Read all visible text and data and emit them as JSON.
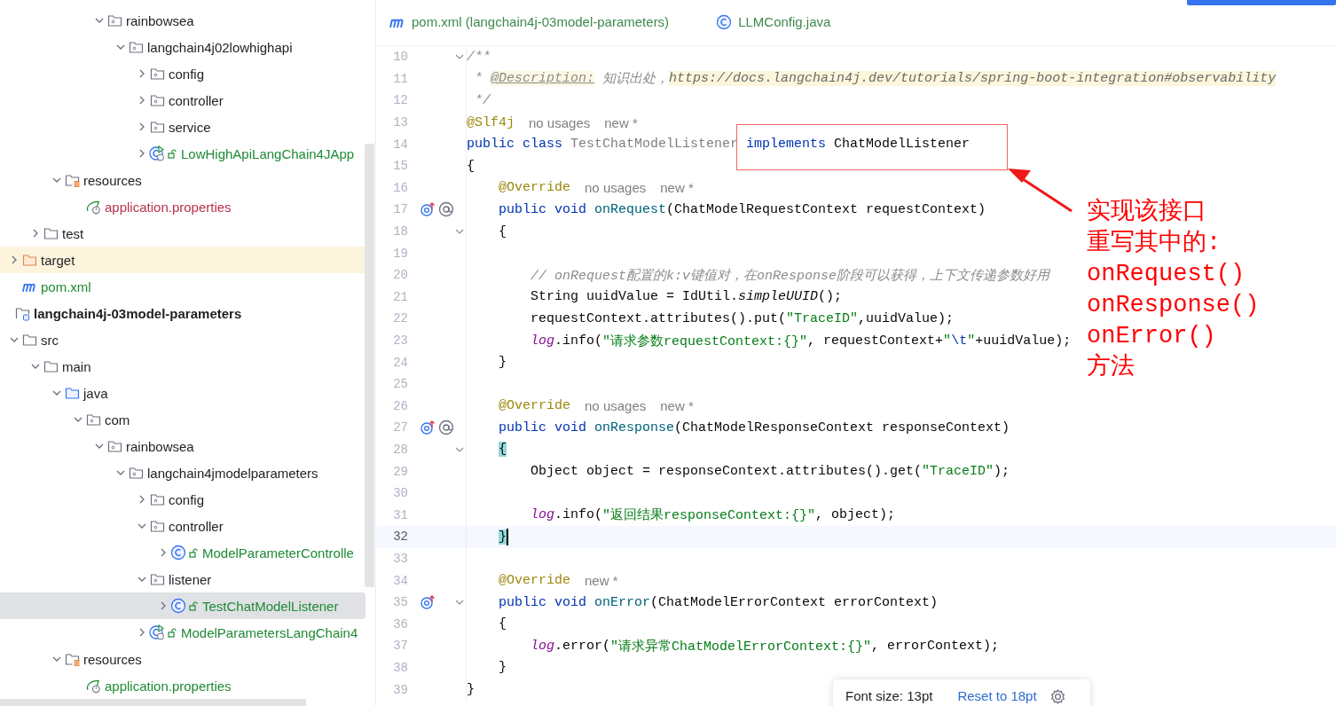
{
  "project_tree": [
    {
      "label": "rainbowsea",
      "kind": "package",
      "expanded": true,
      "selected": false,
      "children": [
        {
          "label": "langchain4j02lowhighapi",
          "kind": "package",
          "expanded": true,
          "selected": false,
          "children": [
            {
              "label": "config",
              "kind": "package",
              "expanded": false,
              "selected": false
            },
            {
              "label": "controller",
              "kind": "package",
              "expanded": false,
              "selected": false
            },
            {
              "label": "service",
              "kind": "package",
              "expanded": false,
              "selected": false
            },
            {
              "label": "LowHighApiLangChain4JApp",
              "kind": "spring-app",
              "expanded": false,
              "selected": false,
              "color": "#1f8a34"
            }
          ]
        }
      ]
    },
    {
      "label": "resources",
      "kind": "resource-folder",
      "expanded": true,
      "selected": false,
      "children": [
        {
          "label": "application.properties",
          "kind": "properties",
          "selected": false,
          "color": "#b8304f"
        }
      ]
    },
    {
      "label": "test",
      "kind": "folder",
      "expanded": false,
      "selected": false
    },
    {
      "label": "target",
      "kind": "excluded-folder",
      "expanded": false,
      "selected": false
    },
    {
      "label": "pom.xml",
      "kind": "maven",
      "selected": false,
      "color": "#1f8a34"
    },
    {
      "label": "langchain4j-03model-parameters",
      "kind": "module",
      "selected": false,
      "children": [
        {
          "label": "src",
          "kind": "folder",
          "expanded": true,
          "selected": false,
          "children": [
            {
              "label": "main",
              "kind": "folder",
              "expanded": true,
              "selected": false,
              "children": [
                {
                  "label": "java",
                  "kind": "source-folder",
                  "expanded": true,
                  "selected": false,
                  "children": [
                    {
                      "label": "com",
                      "kind": "package",
                      "expanded": true,
                      "selected": false,
                      "children": [
                        {
                          "label": "rainbowsea",
                          "kind": "package",
                          "expanded": true,
                          "selected": false,
                          "children": [
                            {
                              "label": "langchain4jmodelparameters",
                              "kind": "package",
                              "expanded": true,
                              "selected": false,
                              "children": [
                                {
                                  "label": "config",
                                  "kind": "package",
                                  "expanded": false,
                                  "selected": false
                                },
                                {
                                  "label": "controller",
                                  "kind": "package",
                                  "expanded": true,
                                  "selected": false,
                                  "children": [
                                    {
                                      "label": "ModelParameterControlle",
                                      "kind": "class",
                                      "expanded": false,
                                      "selected": false,
                                      "color": "#1f8a34"
                                    }
                                  ]
                                },
                                {
                                  "label": "listener",
                                  "kind": "package",
                                  "expanded": true,
                                  "selected": false,
                                  "children": [
                                    {
                                      "label": "TestChatModelListener",
                                      "kind": "class",
                                      "expanded": false,
                                      "selected": true,
                                      "color": "#1f8a34"
                                    }
                                  ]
                                },
                                {
                                  "label": "ModelParametersLangChain4",
                                  "kind": "spring-app",
                                  "expanded": false,
                                  "selected": false,
                                  "color": "#1f8a34"
                                }
                              ]
                            }
                          ]
                        }
                      ]
                    }
                  ]
                },
                {
                  "label": "resources",
                  "kind": "resource-folder",
                  "expanded": true,
                  "selected": false,
                  "children": [
                    {
                      "label": "application.properties",
                      "kind": "properties",
                      "selected": false,
                      "color": "#1f8a34"
                    }
                  ]
                }
              ]
            }
          ]
        }
      ]
    }
  ],
  "tabs": [
    {
      "label": "pom.xml (langchain4j-03model-parameters)",
      "kind": "maven",
      "selected": false
    },
    {
      "label": "LLMConfig.java",
      "kind": "class",
      "selected": false
    }
  ],
  "code_lines": [
    {
      "number": "10",
      "gutter": [
        {
          "kind": "fold"
        }
      ],
      "current": false,
      "tokens": [
        {
          "kind": "comment",
          "text": "/**"
        }
      ]
    },
    {
      "number": "11",
      "current": false,
      "tokens": [
        {
          "kind": "comment",
          "text": " * "
        },
        {
          "kind": "doc-tag",
          "text": "@Description:"
        },
        {
          "kind": "comment",
          "text": " 知识出处，"
        },
        {
          "kind": "link",
          "text": "https://docs.langchain4j.dev/tutorials/spring-boot-integration#observability"
        }
      ]
    },
    {
      "number": "12",
      "current": false,
      "tokens": [
        {
          "kind": "comment",
          "text": " */"
        }
      ]
    },
    {
      "number": "13",
      "current": false,
      "tokens": [
        {
          "kind": "annotation",
          "text": "@Slf4j"
        },
        {
          "kind": "hint",
          "text": "no usages"
        },
        {
          "kind": "hint",
          "text": "new *"
        }
      ]
    },
    {
      "number": "14",
      "current": false,
      "tokens": [
        {
          "kind": "keyword",
          "text": "public class "
        },
        {
          "kind": "unused",
          "text": "TestChatModelListener "
        },
        {
          "kind": "keyword",
          "text": "implements"
        },
        {
          "kind": "plain",
          "text": " ChatModelListener"
        }
      ]
    },
    {
      "number": "15",
      "current": false,
      "tokens": [
        {
          "kind": "plain",
          "text": "{"
        }
      ]
    },
    {
      "number": "16",
      "current": false,
      "tokens": [
        {
          "kind": "annotation",
          "text": "    @Override"
        },
        {
          "kind": "hint",
          "text": "no usages"
        },
        {
          "kind": "hint",
          "text": "new *"
        }
      ]
    },
    {
      "number": "17",
      "gutter": [
        {
          "kind": "implements"
        },
        {
          "kind": "related"
        }
      ],
      "current": false,
      "tokens": [
        {
          "kind": "keyword",
          "text": "    public void "
        },
        {
          "kind": "method",
          "text": "onRequest"
        },
        {
          "kind": "plain",
          "text": "(ChatModelRequestContext requestContext)"
        }
      ]
    },
    {
      "number": "18",
      "gutter": [
        {
          "kind": "fold"
        }
      ],
      "current": false,
      "tokens": [
        {
          "kind": "plain",
          "text": "    {"
        }
      ]
    },
    {
      "number": "19",
      "current": false
    },
    {
      "number": "20",
      "current": false,
      "tokens": [
        {
          "kind": "comment",
          "text": "        // onRequest配置的k:v键值对，在onResponse阶段可以获得，上下文传递参数好用"
        }
      ]
    },
    {
      "number": "21",
      "current": false,
      "tokens": [
        {
          "kind": "plain",
          "text": "        String uuidValue = IdUtil."
        },
        {
          "kind": "static",
          "text": "simpleUUID"
        },
        {
          "kind": "plain",
          "text": "();"
        }
      ]
    },
    {
      "number": "22",
      "current": false,
      "tokens": [
        {
          "kind": "plain",
          "text": "        requestContext.attributes().put("
        },
        {
          "kind": "string",
          "text": "\"TraceID\""
        },
        {
          "kind": "plain",
          "text": ",uuidValue);"
        }
      ]
    },
    {
      "number": "23",
      "current": false,
      "tokens": [
        {
          "kind": "field",
          "text": "        log"
        },
        {
          "kind": "plain",
          "text": ".info("
        },
        {
          "kind": "string",
          "text": "\"请求参数requestContext:{}\""
        },
        {
          "kind": "plain",
          "text": ", requestContext+"
        },
        {
          "kind": "string",
          "text": "\""
        },
        {
          "kind": "escape",
          "text": "\\t"
        },
        {
          "kind": "string",
          "text": "\""
        },
        {
          "kind": "plain",
          "text": "+uuidValue);"
        }
      ]
    },
    {
      "number": "24",
      "current": false,
      "tokens": [
        {
          "kind": "plain",
          "text": "    }"
        }
      ]
    },
    {
      "number": "25",
      "current": false
    },
    {
      "number": "26",
      "current": false,
      "tokens": [
        {
          "kind": "annotation",
          "text": "    @Override"
        },
        {
          "kind": "hint",
          "text": "no usages"
        },
        {
          "kind": "hint",
          "text": "new *"
        }
      ]
    },
    {
      "number": "27",
      "gutter": [
        {
          "kind": "implements"
        },
        {
          "kind": "related"
        }
      ],
      "current": false,
      "tokens": [
        {
          "kind": "keyword",
          "text": "    public void "
        },
        {
          "kind": "method",
          "text": "onResponse"
        },
        {
          "kind": "plain",
          "text": "(ChatModelResponseContext responseContext)"
        }
      ]
    },
    {
      "number": "28",
      "gutter": [
        {
          "kind": "fold"
        }
      ],
      "current": false,
      "tokens": [
        {
          "kind": "brace-match",
          "text": "    {"
        }
      ]
    },
    {
      "number": "29",
      "current": false,
      "tokens": [
        {
          "kind": "plain",
          "text": "        Object object = responseContext.attributes().get("
        },
        {
          "kind": "string",
          "text": "\"TraceID\""
        },
        {
          "kind": "plain",
          "text": ");"
        }
      ]
    },
    {
      "number": "30",
      "current": false
    },
    {
      "number": "31",
      "current": false,
      "tokens": [
        {
          "kind": "field",
          "text": "        log"
        },
        {
          "kind": "plain",
          "text": ".info("
        },
        {
          "kind": "string",
          "text": "\"返回结果responseContext:{}\""
        },
        {
          "kind": "plain",
          "text": ", object);"
        }
      ]
    },
    {
      "number": "32",
      "current": true,
      "tokens": [
        {
          "kind": "brace-match",
          "text": "    }"
        }
      ]
    },
    {
      "number": "33",
      "current": false
    },
    {
      "number": "34",
      "current": false,
      "tokens": [
        {
          "kind": "annotation",
          "text": "    @Override"
        },
        {
          "kind": "hint",
          "text": "new *"
        }
      ]
    },
    {
      "number": "35",
      "gutter": [
        {
          "kind": "implements"
        },
        {
          "kind": "fold"
        }
      ],
      "current": false,
      "tokens": [
        {
          "kind": "keyword",
          "text": "    public void "
        },
        {
          "kind": "method",
          "text": "onError"
        },
        {
          "kind": "plain",
          "text": "(ChatModelErrorContext errorContext)"
        }
      ]
    },
    {
      "number": "36",
      "current": false,
      "tokens": [
        {
          "kind": "plain",
          "text": "    {"
        }
      ]
    },
    {
      "number": "37",
      "current": false,
      "tokens": [
        {
          "kind": "field",
          "text": "        log"
        },
        {
          "kind": "plain",
          "text": ".error("
        },
        {
          "kind": "string",
          "text": "\"请求异常ChatModelErrorContext:{}\""
        },
        {
          "kind": "plain",
          "text": ", errorContext);"
        }
      ]
    },
    {
      "number": "38",
      "current": false,
      "tokens": [
        {
          "kind": "plain",
          "text": "    }"
        }
      ]
    },
    {
      "number": "39",
      "current": false,
      "tokens": [
        {
          "kind": "plain",
          "text": "}"
        }
      ]
    }
  ],
  "callout": {
    "lines": [
      "实现该接口",
      "重写其中的:",
      "onRequest()",
      "onResponse()",
      "onError()",
      "方法"
    ]
  },
  "font_popup": {
    "label": "Font size: 13pt",
    "reset_link": "Reset to 18pt"
  }
}
